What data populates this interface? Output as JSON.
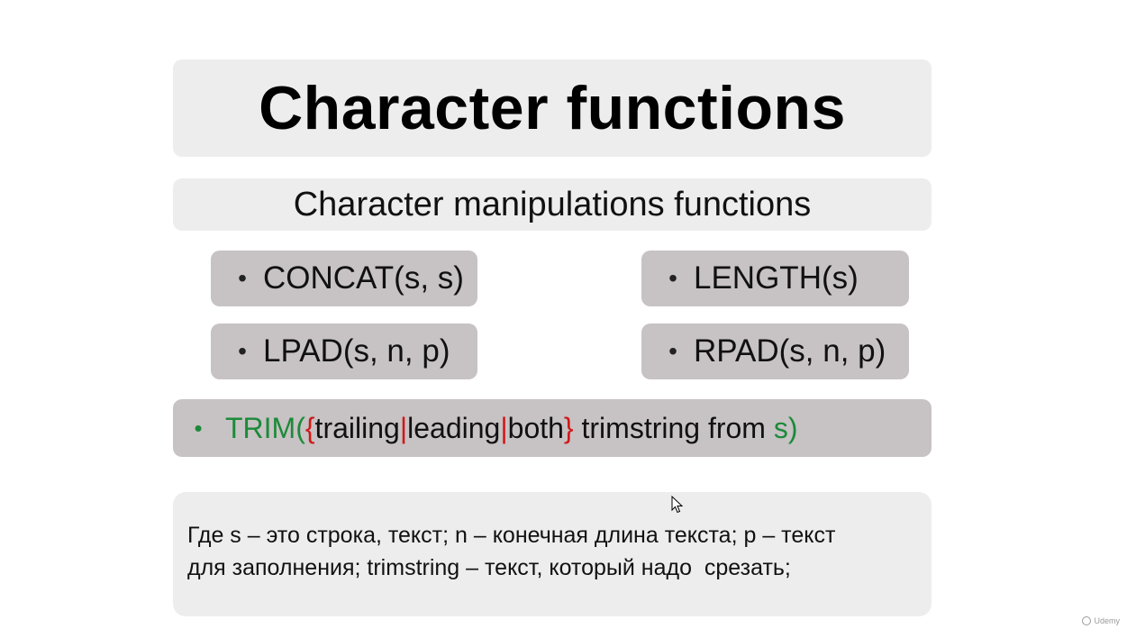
{
  "title": "Character functions",
  "subtitle": "Character manipulations functions",
  "functions": [
    {
      "bullet": "•",
      "text": "CONCAT(s, s)"
    },
    {
      "bullet": "•",
      "text": "LENGTH(s)"
    },
    {
      "bullet": "•",
      "text": "LPAD(s, n, p)"
    },
    {
      "bullet": "•",
      "text": "RPAD(s, n, p)"
    }
  ],
  "trim": {
    "bullet": "•",
    "name": "TRIM(",
    "open_brace": "{",
    "opt1": "trailing",
    "sep1": "|",
    "opt2": "leading",
    "sep2": "|",
    "opt3": "both",
    "close_brace": "}",
    "middle": " trimstring from ",
    "arg": "s)"
  },
  "note": {
    "line1": "Где s – это строка, текст; n – конечная длина текста; p – текст",
    "line2": "для заполнения; trimstring – текст, который надо  срезать;"
  },
  "watermark": "Udemy",
  "colors": {
    "title_bg": "#ededed",
    "function_bg": "#c7c2c3",
    "keyword_green": "#1c8a3a",
    "brace_red": "#d01818"
  }
}
